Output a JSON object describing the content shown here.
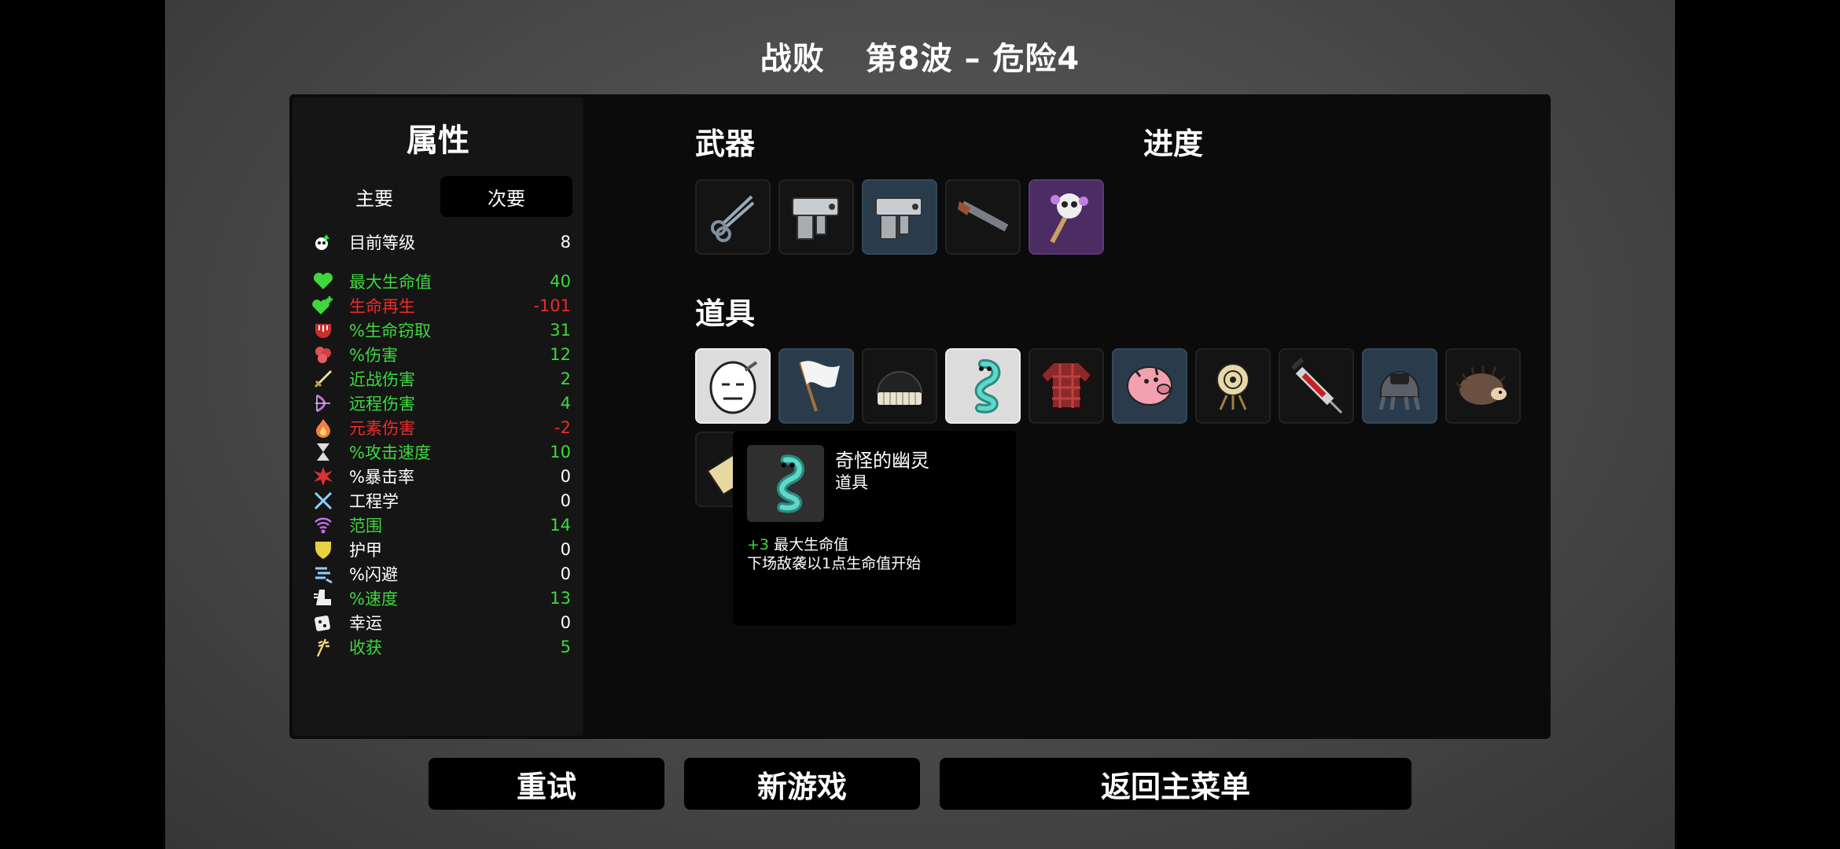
{
  "header": {
    "result": "战败",
    "wave": "第8波 – 危险4"
  },
  "stats": {
    "title": "属性",
    "tabs": {
      "primary": "主要",
      "secondary": "次要"
    },
    "level": {
      "label": "目前等级",
      "value": "8",
      "icon": "level-icon",
      "color": "white"
    },
    "rows": [
      {
        "label": "最大生命值",
        "value": "40",
        "color": "green",
        "icon": "heart-icon"
      },
      {
        "label": "生命再生",
        "value": "-101",
        "color": "red",
        "icon": "regen-icon"
      },
      {
        "label": "%生命窃取",
        "value": "31",
        "color": "green",
        "icon": "lifesteal-icon"
      },
      {
        "label": "%伤害",
        "value": "12",
        "color": "green",
        "icon": "damage-icon"
      },
      {
        "label": "近战伤害",
        "value": "2",
        "color": "green",
        "icon": "sword-icon"
      },
      {
        "label": "远程伤害",
        "value": "4",
        "color": "green",
        "icon": "bow-icon"
      },
      {
        "label": "元素伤害",
        "value": "-2",
        "color": "red",
        "icon": "flame-icon"
      },
      {
        "label": "%攻击速度",
        "value": "10",
        "color": "green",
        "icon": "hourglass-icon"
      },
      {
        "label": "%暴击率",
        "value": "0",
        "color": "white",
        "icon": "crit-icon"
      },
      {
        "label": "工程学",
        "value": "0",
        "color": "white",
        "icon": "wrench-icon"
      },
      {
        "label": "范围",
        "value": "14",
        "color": "green",
        "icon": "range-icon"
      },
      {
        "label": "护甲",
        "value": "0",
        "color": "white",
        "icon": "shield-icon"
      },
      {
        "label": "%闪避",
        "value": "0",
        "color": "white",
        "icon": "dodge-icon"
      },
      {
        "label": "%速度",
        "value": "13",
        "color": "green",
        "icon": "boot-icon"
      },
      {
        "label": "幸运",
        "value": "0",
        "color": "white",
        "icon": "dice-icon"
      },
      {
        "label": "收获",
        "value": "5",
        "color": "green",
        "icon": "harvest-icon"
      }
    ]
  },
  "weapons": {
    "title": "武器",
    "items": [
      {
        "name": "scissors-icon",
        "tier": "common"
      },
      {
        "name": "gun-turret-icon",
        "tier": "common"
      },
      {
        "name": "gun-turret-icon",
        "tier": "uncommon"
      },
      {
        "name": "shotgun-icon",
        "tier": "common"
      },
      {
        "name": "skull-staff-icon",
        "tier": "rare"
      }
    ]
  },
  "progress": {
    "title": "进度"
  },
  "items": {
    "title": "道具",
    "list": [
      {
        "name": "egg-face-icon",
        "tier": "white"
      },
      {
        "name": "white-flag-icon",
        "tier": "uncommon"
      },
      {
        "name": "beanie-icon",
        "tier": "common"
      },
      {
        "name": "ghost-icon",
        "tier": "white"
      },
      {
        "name": "plaid-shirt-icon",
        "tier": "common"
      },
      {
        "name": "piggy-bank-icon",
        "tier": "uncommon"
      },
      {
        "name": "target-dummy-icon",
        "tier": "common"
      },
      {
        "name": "syringe-icon",
        "tier": "common"
      },
      {
        "name": "diving-helmet-icon",
        "tier": "uncommon"
      },
      {
        "name": "hedgehog-icon",
        "tier": "common"
      },
      {
        "name": "ticket-icon",
        "tier": "common"
      }
    ]
  },
  "tooltip": {
    "name": "奇怪的幽灵",
    "type": "道具",
    "bonus_value": "+3",
    "bonus_text": "最大生命值",
    "description": "下场敌袭以1点生命值开始"
  },
  "buttons": {
    "retry": "重试",
    "new_game": "新游戏",
    "main_menu": "返回主菜单"
  },
  "colors": {
    "green": "#3ed83e",
    "red": "#ee2a2a",
    "uncommon_bg": "#2a3c4c",
    "rare_bg": "#4d2c63"
  }
}
